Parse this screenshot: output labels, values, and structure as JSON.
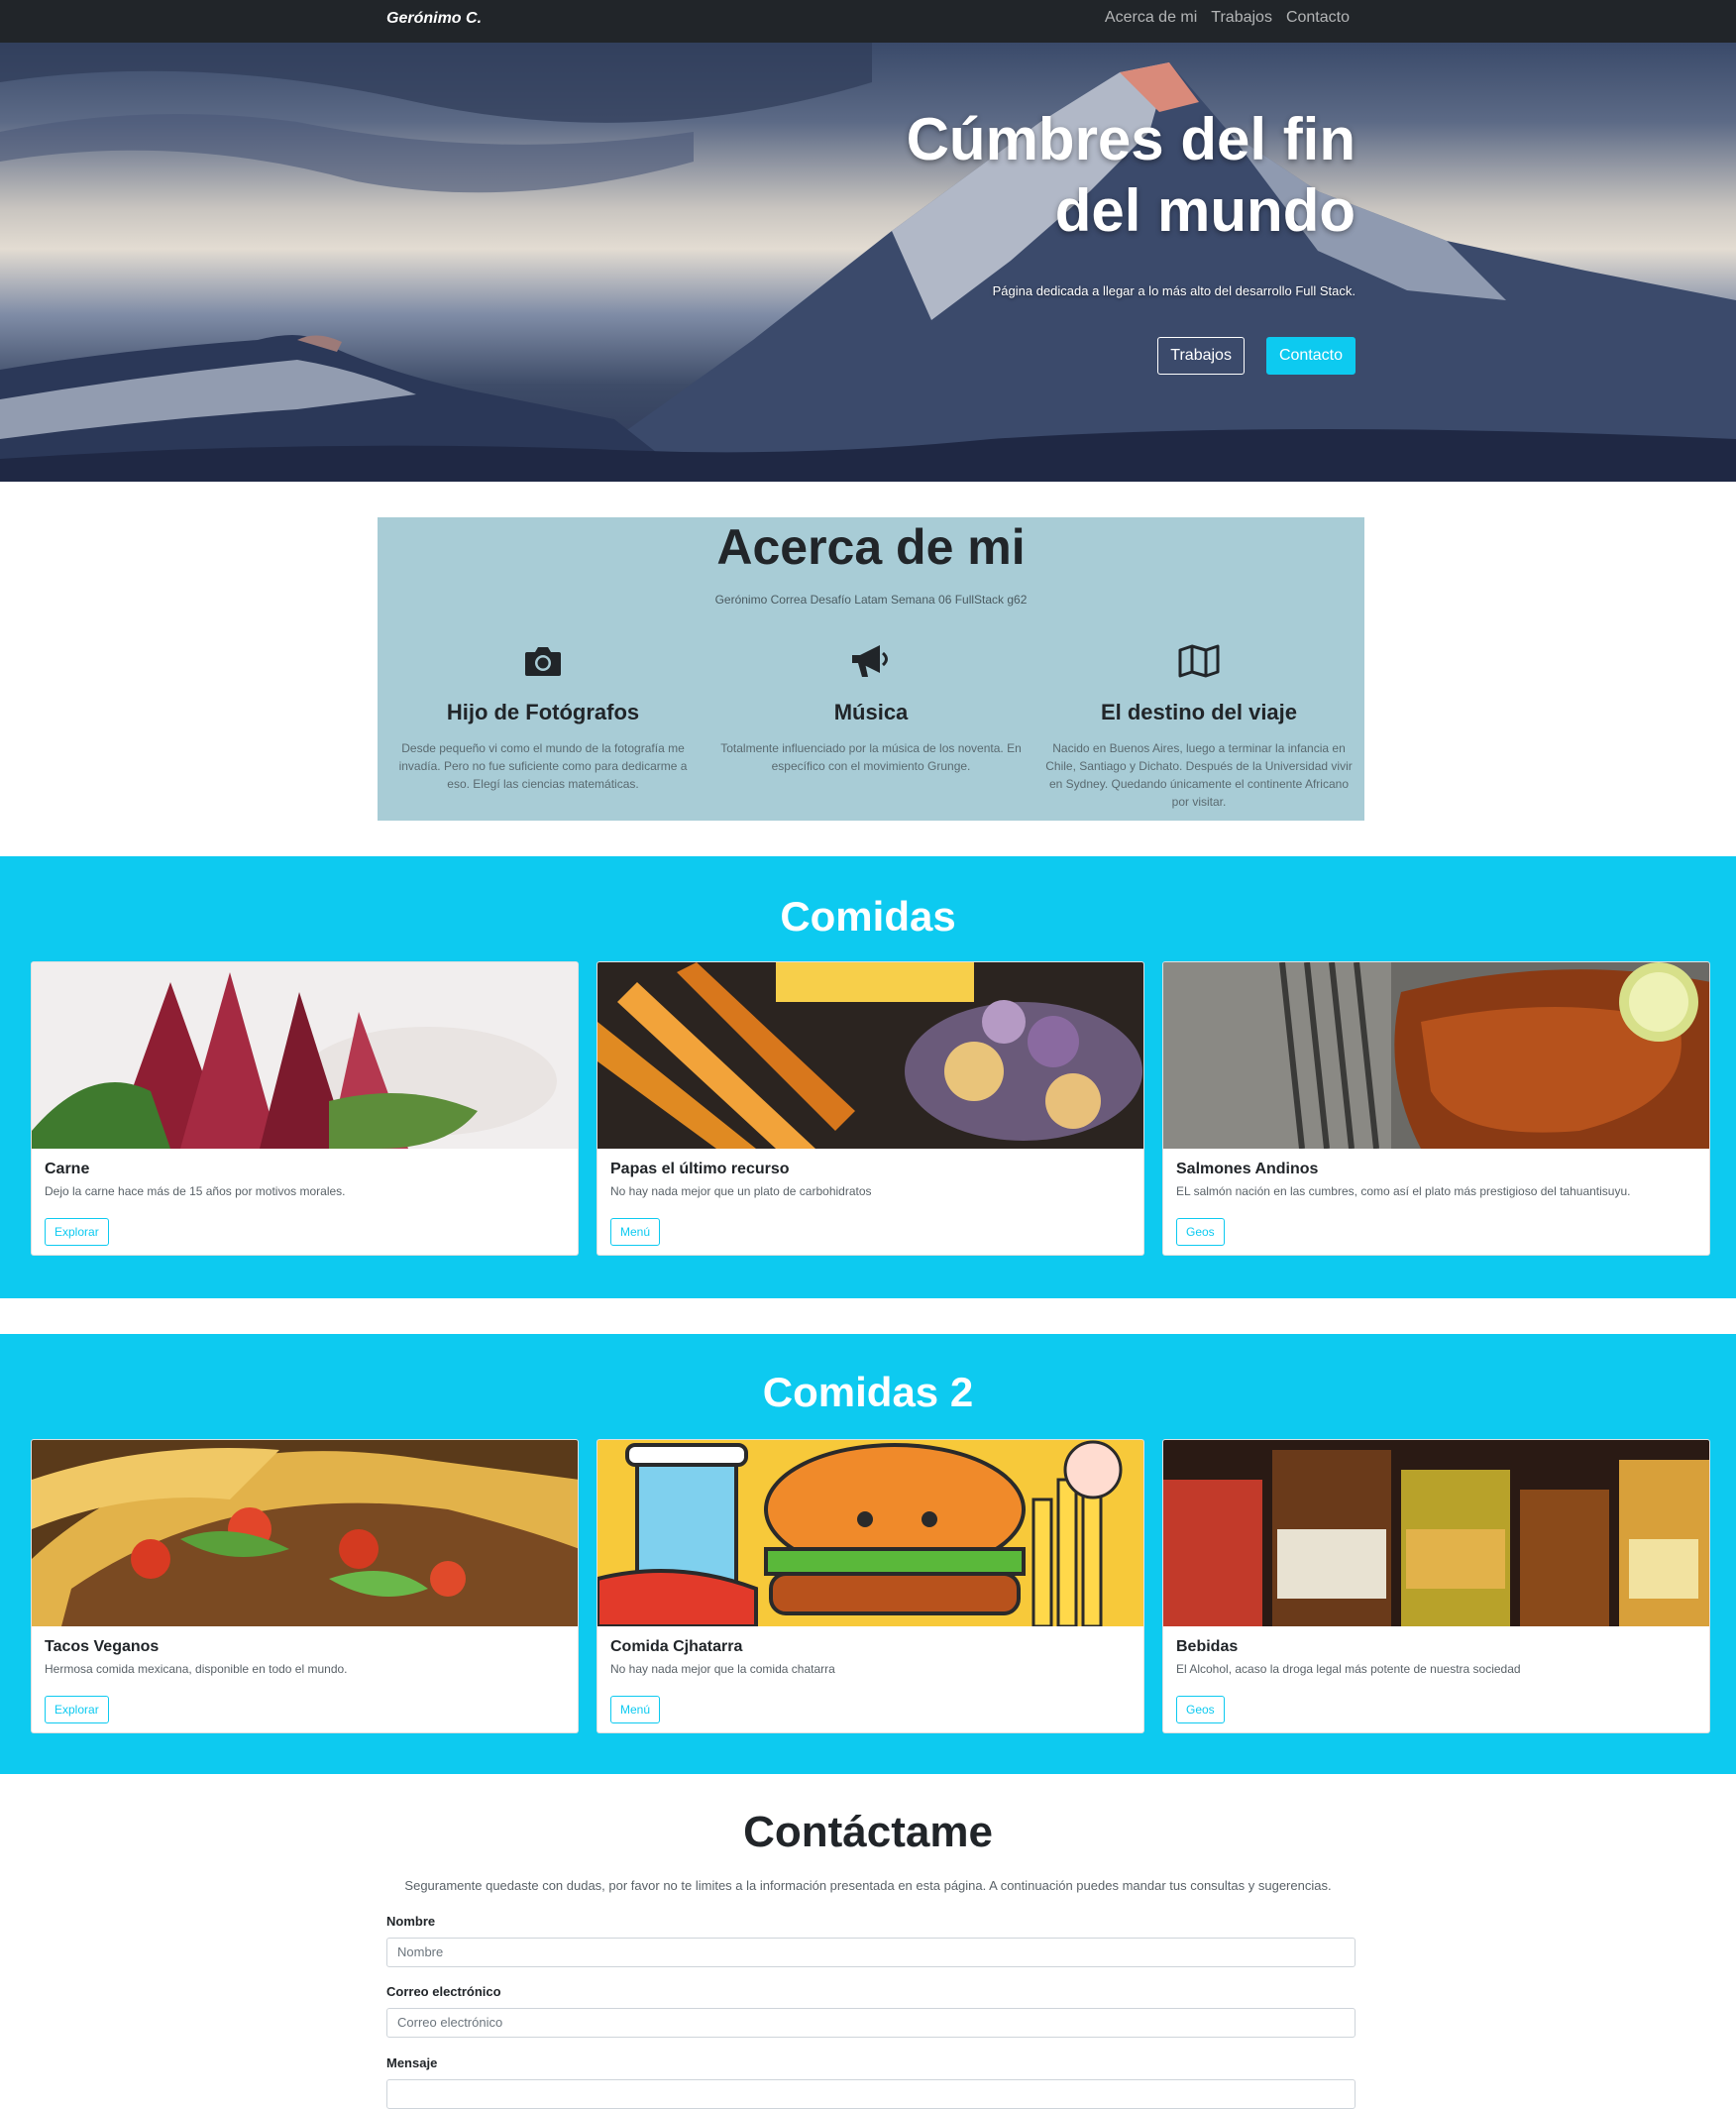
{
  "navbar": {
    "brand": "Gerónimo C.",
    "links": [
      "Acerca de mi",
      "Trabajos",
      "Contacto"
    ]
  },
  "hero": {
    "title_line1": "Cúmbres del fin",
    "title_line2": "del mundo",
    "subtitle": "Página dedicada a llegar a lo más alto del desarrollo Full Stack.",
    "btn_trabajos": "Trabajos",
    "btn_contacto": "Contacto"
  },
  "about": {
    "title": "Acerca de mi",
    "subtitle": "Gerónimo Correa Desafío Latam Semana 06 FullStack g62",
    "features": [
      {
        "icon": "camera-icon",
        "title": "Hijo de Fotógrafos",
        "text": "Desde pequeño vi como el mundo de la fotografía me invadía. Pero no fue suficiente como para dedicarme a eso. Elegí las ciencias matemáticas."
      },
      {
        "icon": "megaphone-icon",
        "title": "Música",
        "text": "Totalmente influenciado por la música de los noventa. En específico con el movimiento Grunge."
      },
      {
        "icon": "map-icon",
        "title": "El destino del viaje",
        "text": "Nacido en Buenos Aires, luego a terminar la infancia en Chile, Santiago y Dichato. Después de la Universidad vivir en Sydney. Quedando únicamente el continente Africano por visitar."
      }
    ]
  },
  "comidas": {
    "title": "Comidas",
    "cards": [
      {
        "title": "Carne",
        "text": "Dejo la carne hace más de 15 años por motivos morales.",
        "button": "Explorar"
      },
      {
        "title": "Papas el último recurso",
        "text": "No hay nada mejor que un plato de carbohidratos",
        "button": "Menú"
      },
      {
        "title": "Salmones Andinos",
        "text": "EL salmón nación en las cumbres, como así el plato más prestigioso del tahuantisuyu.",
        "button": "Geos"
      }
    ]
  },
  "comidas2": {
    "title": "Comidas 2",
    "cards": [
      {
        "title": "Tacos Veganos",
        "text": "Hermosa comida mexicana, disponible en todo el mundo.",
        "button": "Explorar"
      },
      {
        "title": "Comida Cjhatarra",
        "text": "No hay nada mejor que la comida chatarra",
        "button": "Menú"
      },
      {
        "title": "Bebidas",
        "text": "El Alcohol, acaso la droga legal más potente de nuestra sociedad",
        "button": "Geos"
      }
    ]
  },
  "contact": {
    "title": "Contáctame",
    "text": "Seguramente quedaste con dudas, por favor no te limites a la información presentada en esta página. A continuación puedes mandar tus consultas y sugerencias.",
    "name_label": "Nombre",
    "name_placeholder": "Nombre",
    "email_label": "Correo electrónico",
    "email_placeholder": "Correo electrónico",
    "message_label": "Mensaje"
  },
  "colors": {
    "navbar": "#212529",
    "accent": "#0dcaf0",
    "about_bg": "#a8ccd6"
  }
}
